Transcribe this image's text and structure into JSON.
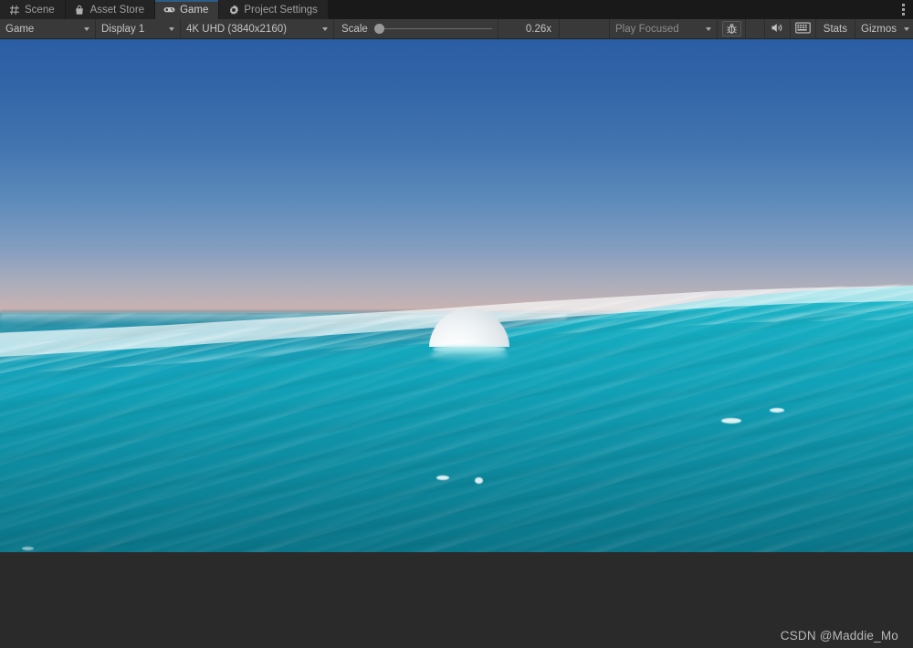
{
  "window": {
    "menu_icon": "kebab-menu-icon"
  },
  "tabs": [
    {
      "label": "Scene",
      "icon": "grid-icon",
      "active": false
    },
    {
      "label": "Asset Store",
      "icon": "shopping-bag-icon",
      "active": false
    },
    {
      "label": "Game",
      "icon": "gamepad-icon",
      "active": true
    },
    {
      "label": "Project Settings",
      "icon": "gear-icon",
      "active": false
    }
  ],
  "toolbar": {
    "view_mode": "Game",
    "display": "Display 1",
    "resolution": "4K UHD (3840x2160)",
    "scale_label": "Scale",
    "scale_value": "0.26x",
    "scale_percent": 4,
    "play_mode": "Play Focused",
    "debug_icon": "bug-icon",
    "mute_audio_icon": "speaker-icon",
    "aspect_icon": "grid-frame-icon",
    "stats_label": "Stats",
    "gizmos_label": "Gizmos"
  },
  "gameview": {
    "scene_description": "Ocean water simulation with white buoy sphere",
    "watermark": "CSDN @Maddie_Mo",
    "colors": {
      "sky_top": "#2a5da3",
      "sky_horizon": "#cdb6b3",
      "water_light": "#17a0b8",
      "water_deep": "#0d8398",
      "foam": "#ffffff",
      "sphere": "#f2f6f8",
      "accent_tab": "#2c5d87"
    }
  }
}
